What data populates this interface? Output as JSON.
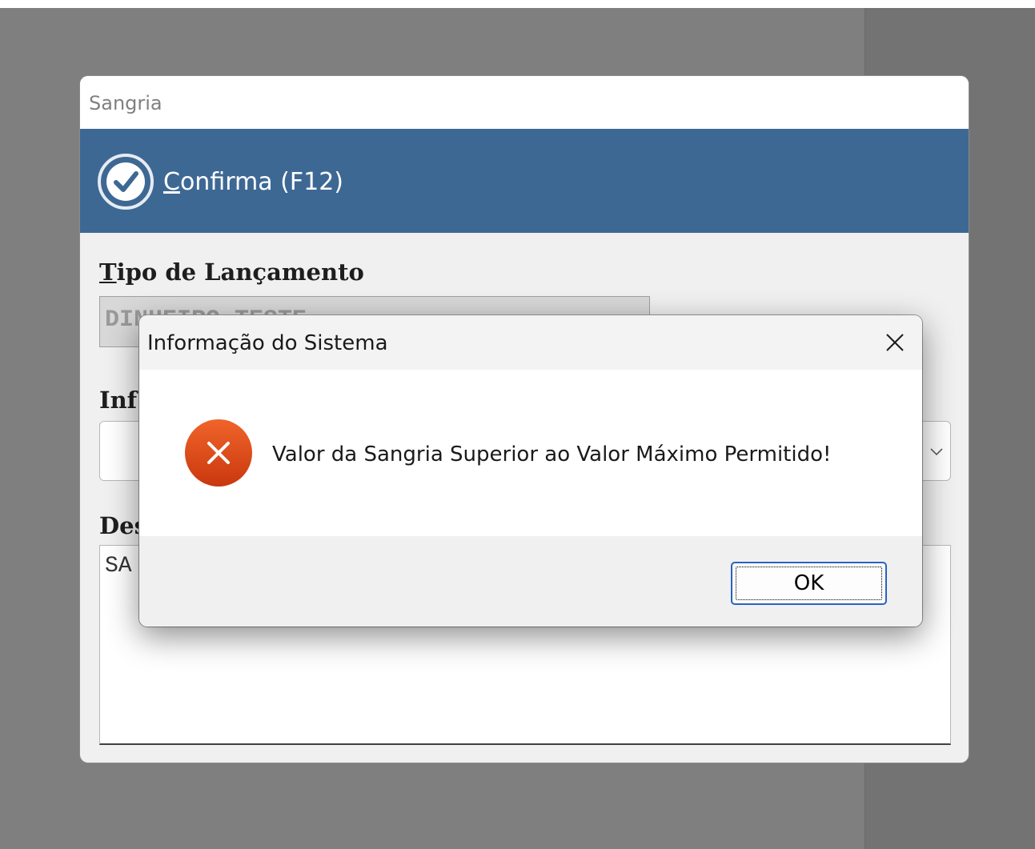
{
  "window": {
    "title": "Sangria",
    "confirm_button": {
      "mnemonic": "C",
      "label_rest": "onfirma (F12)",
      "icon": "check-circle-icon"
    },
    "fields": {
      "tipo_label_mnemonic": "T",
      "tipo_label_rest": "ipo de Lançamento",
      "tipo_value": "DINHEIRO TESTE",
      "info_label": "Inf",
      "desc_label": "Des",
      "desc_value": "SA"
    }
  },
  "dialog": {
    "title": "Informação do Sistema",
    "message": "Valor da Sangria Superior ao Valor Máximo Permitido!",
    "ok_label": "OK",
    "icon": "error-icon"
  },
  "colors": {
    "toolbar": "#3e6894",
    "error": "#e0501c",
    "ok_border": "#2a62c3"
  }
}
